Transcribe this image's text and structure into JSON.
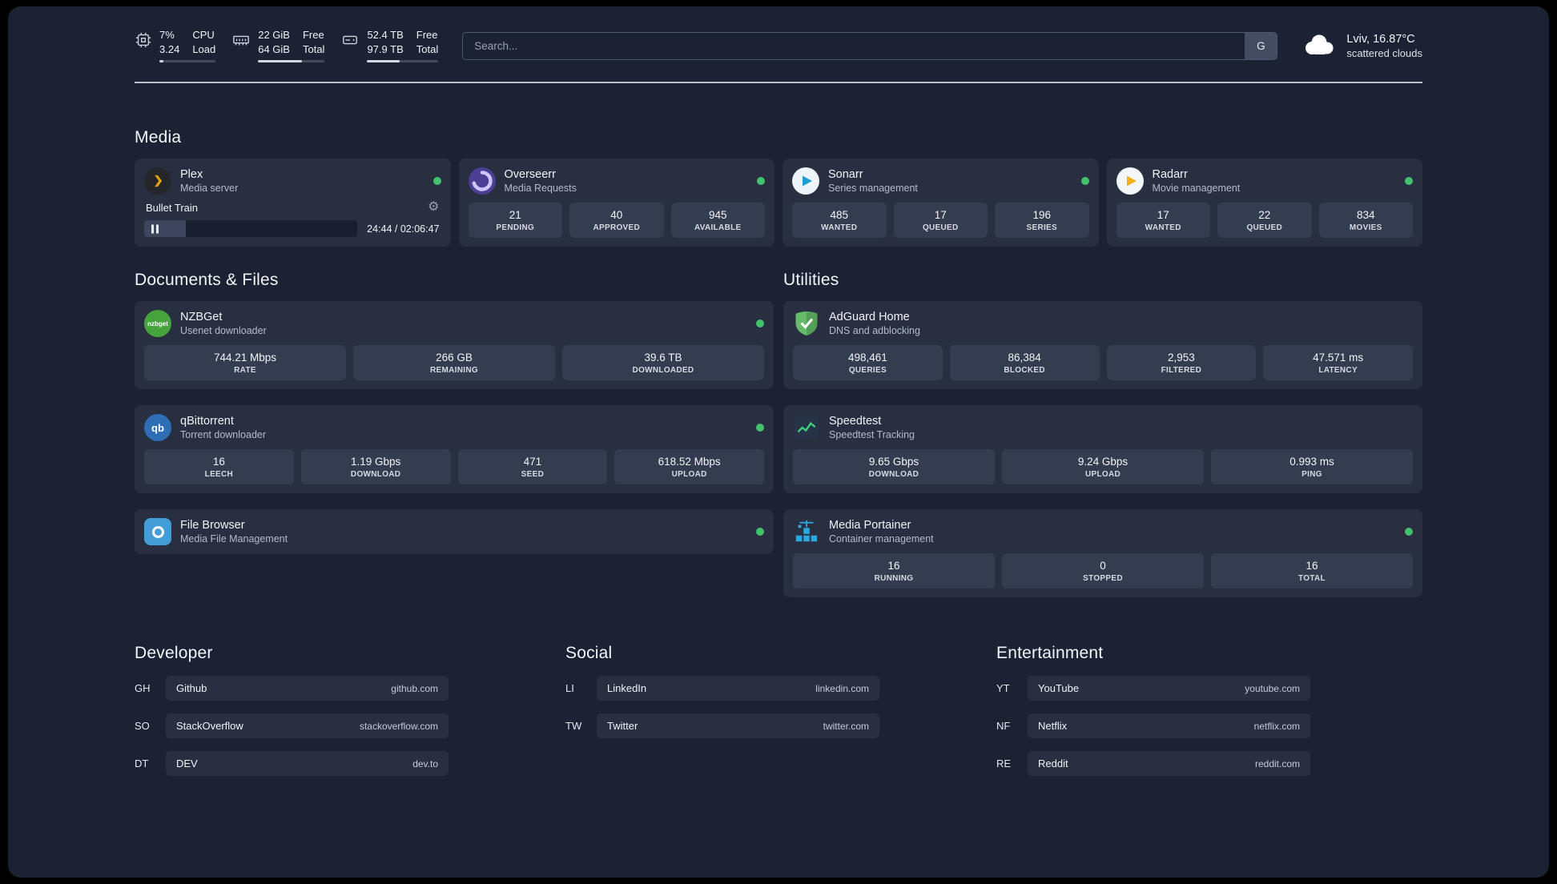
{
  "colors": {
    "panel_bg": "#1a2233",
    "card_bg": "#272f41",
    "tile_bg": "#343c4f",
    "text": "#f1f4f8",
    "muted": "#b4bbc8",
    "online": "#44c16c",
    "divider": "#ccd2db",
    "search_border": "#4d566b",
    "bar_fill": "#d2d7e0"
  },
  "topbar": {
    "cpu": {
      "value_top": "7%",
      "value_bottom": "3.24",
      "label_top": "CPU",
      "label_bottom": "Load",
      "bar_percent": 7,
      "bar_style": "width:7%"
    },
    "memory": {
      "value_top": "22 GiB",
      "value_bottom": "64 GiB",
      "label_top": "Free",
      "label_bottom": "Total",
      "bar_percent": 66,
      "bar_style": "width:66%"
    },
    "disk": {
      "value_top": "52.4 TB",
      "value_bottom": "97.9 TB",
      "label_top": "Free",
      "label_bottom": "Total",
      "bar_percent": 46,
      "bar_style": "width:46%"
    },
    "search": {
      "placeholder": "Search...",
      "shortcut": "G"
    },
    "weather": {
      "location": "Lviv, 16.87°C",
      "condition": "scattered clouds"
    }
  },
  "media": {
    "title": "Media",
    "plex": {
      "name": "Plex",
      "subtitle": "Media server",
      "online": true,
      "now_playing": "Bullet Train",
      "time": "24:44 / 02:06:47",
      "progress_percent": 19.5,
      "progress_style": "width:19.5%"
    },
    "overseerr": {
      "name": "Overseerr",
      "subtitle": "Media Requests",
      "online": true,
      "stats": [
        {
          "value": "21",
          "label": "PENDING"
        },
        {
          "value": "40",
          "label": "APPROVED"
        },
        {
          "value": "945",
          "label": "AVAILABLE"
        }
      ]
    },
    "sonarr": {
      "name": "Sonarr",
      "subtitle": "Series management",
      "online": true,
      "stats": [
        {
          "value": "485",
          "label": "WANTED"
        },
        {
          "value": "17",
          "label": "QUEUED"
        },
        {
          "value": "196",
          "label": "SERIES"
        }
      ]
    },
    "radarr": {
      "name": "Radarr",
      "subtitle": "Movie management",
      "online": true,
      "stats": [
        {
          "value": "17",
          "label": "WANTED"
        },
        {
          "value": "22",
          "label": "QUEUED"
        },
        {
          "value": "834",
          "label": "MOVIES"
        }
      ]
    }
  },
  "documents": {
    "title": "Documents & Files",
    "nzbget": {
      "name": "NZBGet",
      "subtitle": "Usenet downloader",
      "online": true,
      "icon_text": "nzbget",
      "stats": [
        {
          "value": "744.21 Mbps",
          "label": "RATE"
        },
        {
          "value": "266 GB",
          "label": "REMAINING"
        },
        {
          "value": "39.6 TB",
          "label": "DOWNLOADED"
        }
      ]
    },
    "qbittorrent": {
      "name": "qBittorrent",
      "subtitle": "Torrent downloader",
      "online": true,
      "icon_text": "qb",
      "stats": [
        {
          "value": "16",
          "label": "LEECH"
        },
        {
          "value": "1.19 Gbps",
          "label": "DOWNLOAD"
        },
        {
          "value": "471",
          "label": "SEED"
        },
        {
          "value": "618.52 Mbps",
          "label": "UPLOAD"
        }
      ]
    },
    "filebrowser": {
      "name": "File Browser",
      "subtitle": "Media File Management",
      "online": true
    }
  },
  "utilities": {
    "title": "Utilities",
    "adguard": {
      "name": "AdGuard Home",
      "subtitle": "DNS and adblocking",
      "stats": [
        {
          "value": "498,461",
          "label": "QUERIES"
        },
        {
          "value": "86,384",
          "label": "BLOCKED"
        },
        {
          "value": "2,953",
          "label": "FILTERED"
        },
        {
          "value": "47.571 ms",
          "label": "LATENCY"
        }
      ]
    },
    "speedtest": {
      "name": "Speedtest",
      "subtitle": "Speedtest Tracking",
      "stats": [
        {
          "value": "9.65 Gbps",
          "label": "DOWNLOAD"
        },
        {
          "value": "9.24 Gbps",
          "label": "UPLOAD"
        },
        {
          "value": "0.993 ms",
          "label": "PING"
        }
      ]
    },
    "portainer": {
      "name": "Media Portainer",
      "subtitle": "Container management",
      "online": true,
      "stats": [
        {
          "value": "16",
          "label": "RUNNING"
        },
        {
          "value": "0",
          "label": "STOPPED"
        },
        {
          "value": "16",
          "label": "TOTAL"
        }
      ]
    }
  },
  "bookmarks": {
    "developer": {
      "title": "Developer",
      "items": [
        {
          "abbr": "GH",
          "name": "Github",
          "url": "github.com"
        },
        {
          "abbr": "SO",
          "name": "StackOverflow",
          "url": "stackoverflow.com"
        },
        {
          "abbr": "DT",
          "name": "DEV",
          "url": "dev.to"
        }
      ]
    },
    "social": {
      "title": "Social",
      "items": [
        {
          "abbr": "LI",
          "name": "LinkedIn",
          "url": "linkedin.com"
        },
        {
          "abbr": "TW",
          "name": "Twitter",
          "url": "twitter.com"
        }
      ]
    },
    "entertainment": {
      "title": "Entertainment",
      "items": [
        {
          "abbr": "YT",
          "name": "YouTube",
          "url": "youtube.com"
        },
        {
          "abbr": "NF",
          "name": "Netflix",
          "url": "netflix.com"
        },
        {
          "abbr": "RE",
          "name": "Reddit",
          "url": "reddit.com"
        }
      ]
    }
  }
}
